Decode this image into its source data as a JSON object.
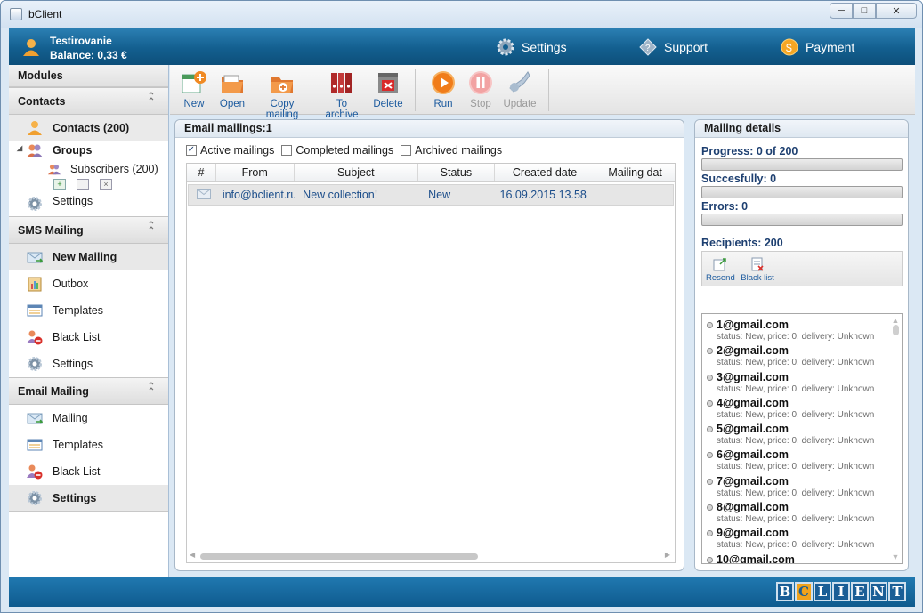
{
  "window": {
    "title": "bClient"
  },
  "header": {
    "user_name": "Testirovanie",
    "balance": "Balance: 0,33 €",
    "nav": [
      {
        "label": "Settings",
        "icon": "gear-icon"
      },
      {
        "label": "Support",
        "icon": "diamond-question-icon"
      },
      {
        "label": "Payment",
        "icon": "dollar-coin-icon"
      }
    ]
  },
  "sidebar": {
    "header": "Modules",
    "contacts": {
      "title": "Contacts",
      "items": [
        "Contacts (200)",
        "Groups",
        "Subscribers (200)",
        "Settings"
      ]
    },
    "sms": {
      "title": "SMS Mailing",
      "items": [
        "New Mailing",
        "Outbox",
        "Templates",
        "Black List",
        "Settings"
      ]
    },
    "email": {
      "title": "Email Mailing",
      "items": [
        "Mailing",
        "Templates",
        "Black List",
        "Settings"
      ]
    }
  },
  "toolbar": {
    "new": "New",
    "open": "Open",
    "copy": "Copy mailing",
    "archive": "To archive",
    "delete": "Delete",
    "run": "Run",
    "stop": "Stop",
    "update": "Update"
  },
  "mailings": {
    "title": "Email mailings:1",
    "filters": [
      {
        "label": "Active mailings",
        "checked": true
      },
      {
        "label": "Completed mailings",
        "checked": false
      },
      {
        "label": "Archived mailings",
        "checked": false
      }
    ],
    "columns": [
      "#",
      "From",
      "Subject",
      "Status",
      "Created date",
      "Mailing dat"
    ],
    "rows": [
      {
        "from": "info@bclient.ru",
        "subject": "New collection!",
        "status": "New",
        "created": "16.09.2015 13.58",
        "mailing": ""
      }
    ]
  },
  "details": {
    "title": "Mailing details",
    "progress": "Progress: 0 of 200",
    "progress_value": 0,
    "success": "Succesfully: 0",
    "errors": "Errors: 0",
    "recipients": "Recipients: 200",
    "resend": "Resend",
    "blacklist": "Black list",
    "list": [
      {
        "email": "1@gmail.com",
        "status": "status: New, price: 0, delivery: Unknown"
      },
      {
        "email": "2@gmail.com",
        "status": "status: New, price: 0, delivery: Unknown"
      },
      {
        "email": "3@gmail.com",
        "status": "status: New, price: 0, delivery: Unknown"
      },
      {
        "email": "4@gmail.com",
        "status": "status: New, price: 0, delivery: Unknown"
      },
      {
        "email": "5@gmail.com",
        "status": "status: New, price: 0, delivery: Unknown"
      },
      {
        "email": "6@gmail.com",
        "status": "status: New, price: 0, delivery: Unknown"
      },
      {
        "email": "7@gmail.com",
        "status": "status: New, price: 0, delivery: Unknown"
      },
      {
        "email": "8@gmail.com",
        "status": "status: New, price: 0, delivery: Unknown"
      },
      {
        "email": "9@gmail.com",
        "status": "status: New, price: 0, delivery: Unknown"
      },
      {
        "email": "10@gmail.com",
        "status": ""
      }
    ]
  },
  "footer": {
    "logo": [
      "B",
      "C",
      "L",
      "I",
      "E",
      "N",
      "T"
    ]
  },
  "colors": {
    "accent": "#135f8f",
    "link": "#1b5a9e"
  }
}
